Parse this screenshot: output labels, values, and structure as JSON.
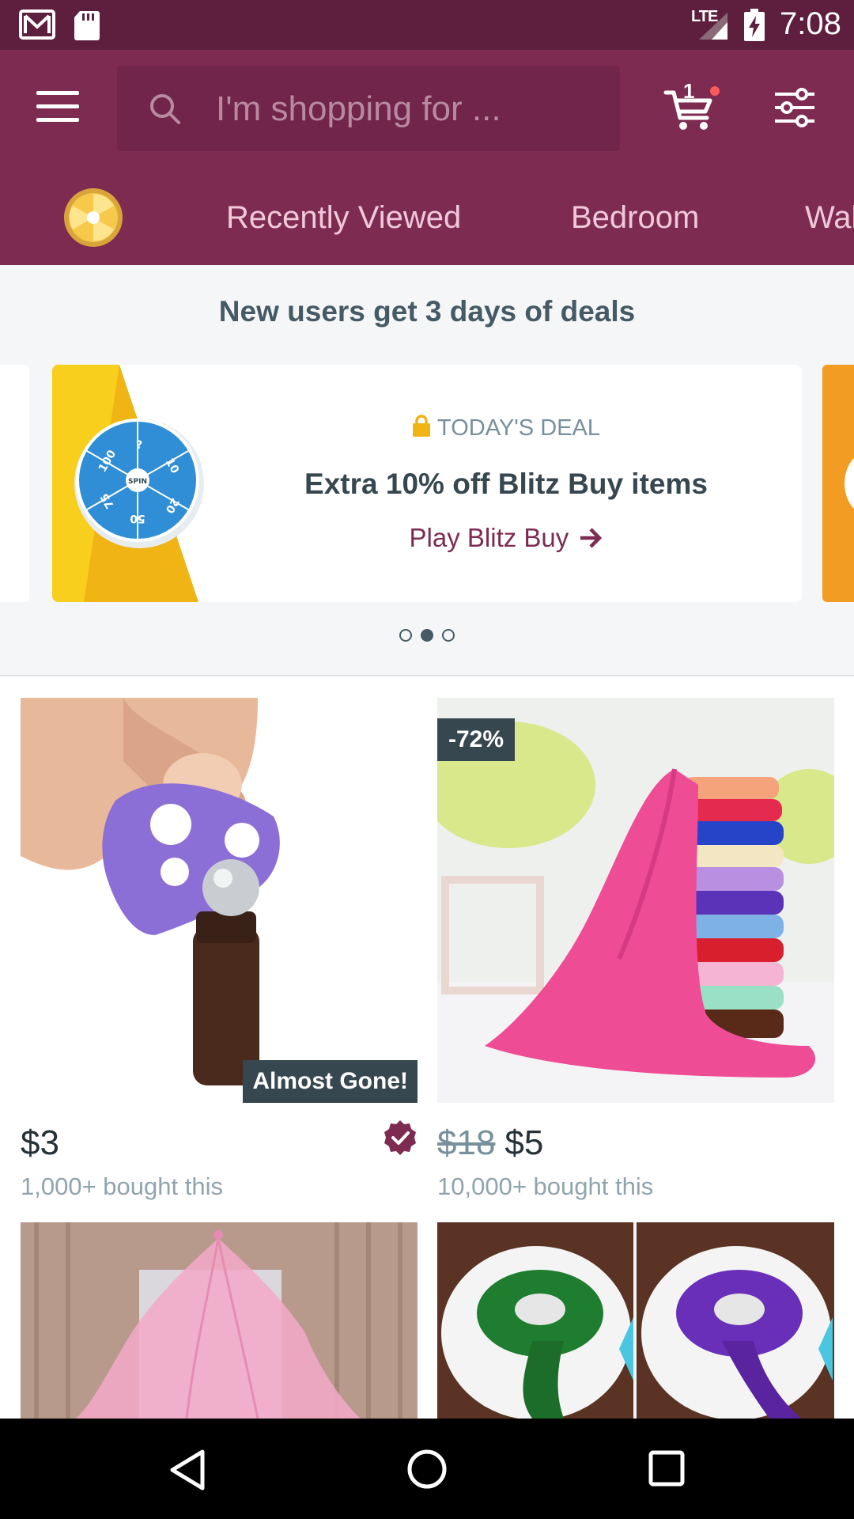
{
  "status_bar": {
    "network": "LTE",
    "time": "7:08",
    "icons": [
      "gmail-icon",
      "sd-card-icon",
      "signal-icon",
      "battery-charging-icon"
    ]
  },
  "header": {
    "menu_icon": "hamburger-icon",
    "search": {
      "placeholder": "I'm shopping for ..."
    },
    "cart": {
      "count": "1"
    },
    "filter_icon": "sliders-icon"
  },
  "tabs": [
    {
      "label": "Recently Viewed"
    },
    {
      "label": "Bedroom"
    },
    {
      "label": "Wal"
    }
  ],
  "promo": {
    "heading": "New users get 3 days of deals",
    "card": {
      "tag": "TODAY'S DEAL",
      "title": "Extra 10% off Blitz Buy items",
      "link": "Play Blitz Buy",
      "wheel_labels": [
        "?",
        "10",
        "20",
        "50",
        "75",
        "100",
        "SPIN"
      ]
    },
    "carousel": {
      "count": 3,
      "active": 2
    }
  },
  "products": [
    {
      "price": "$3",
      "bought": "1,000+ bought this",
      "badge": "Almost Gone!",
      "verified": true
    },
    {
      "old_price": "$18",
      "price": "$5",
      "bought": "10,000+ bought this",
      "discount": "-72%"
    },
    {
      "image": "pink-canopy-net"
    },
    {
      "image": "satin-ribbon-rolls"
    }
  ],
  "colors": {
    "status_bar": "#5e1f3e",
    "app_bar": "#7e2b52",
    "search_bg": "#72254a",
    "accent": "#7e2b52",
    "text_dark": "#37474f"
  }
}
